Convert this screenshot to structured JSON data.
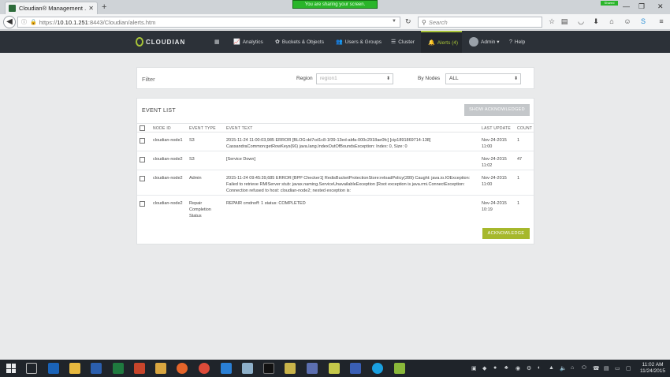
{
  "browser": {
    "tab_title": "Cloudian® Management ...",
    "tab_close": "✕",
    "new_tab": "+",
    "sharing_banner": "You are sharing your screen.",
    "sharing_mini": "Shared",
    "win_min": "—",
    "win_max": "❐",
    "win_close": "✕",
    "url_prefix": "https://",
    "url_host": "10.10.1.251",
    "url_path": ":8443/Cloudian/alerts.htm",
    "search_placeholder": "Search"
  },
  "app": {
    "logo_text": "CLOUDIAN",
    "nav": {
      "analytics": "Analytics",
      "buckets": "Buckets & Objects",
      "users": "Users & Groups",
      "cluster": "Cluster",
      "alerts": "Alerts (4)",
      "admin": "Admin ▾",
      "help": "Help"
    }
  },
  "filter": {
    "label": "Filter",
    "region_label": "Region",
    "region_value": "region1",
    "nodes_label": "By Nodes",
    "nodes_value": "ALL"
  },
  "events": {
    "title": "EVENT LIST",
    "show_ack_button": "SHOW ACKNOWLEDGED",
    "ack_button": "ACKNOWLEDGE",
    "columns": {
      "node": "NODE ID",
      "type": "EVENT TYPE",
      "text": "EVENT TEXT",
      "updated": "LAST UPDATE",
      "count": "COUNT"
    },
    "rows": [
      {
        "node": "cloudian-node1",
        "type": "S3",
        "text": "2015-11-24 11:00:03,985 ERROR [BLOG:dd7cd1c8-1f39-13ed-abfa-000c2918ae0fc] [cip1891869714-138] CassandraCommon:getRowKeys(66) java.lang.IndexOutOfBoundsException: Index: 0, Size: 0",
        "updated": "Nov-24-2015 11:00",
        "count": "1"
      },
      {
        "node": "cloudian-node2",
        "type": "S3",
        "text": "[Service Down]",
        "updated": "Nov-24-2015 11:02",
        "count": "47"
      },
      {
        "node": "cloudian-node2",
        "type": "Admin",
        "text": "2015-11-24 09:45:39,685 ERROR [BPP Checker1] RedisBucketProtectionStore:reloadPolicy(289) Caught: java.io.IOException: Failed to retrieve RMIServer stub: javax.naming.ServiceUnavailableException [Root exception is java.rmi.ConnectException: Connection refused to host: cloudian-node2; nested exception is:",
        "updated": "Nov-24-2015 11:00",
        "count": "1"
      },
      {
        "node": "cloudian-node2",
        "type": "Repair Completion Status",
        "text": "REPAIR cmdnoff: 1 status: COMPLETED",
        "updated": "Nov-24-2015 10:19",
        "count": "1"
      }
    ]
  },
  "taskbar": {
    "time": "11:02 AM",
    "date": "11/24/2015"
  }
}
